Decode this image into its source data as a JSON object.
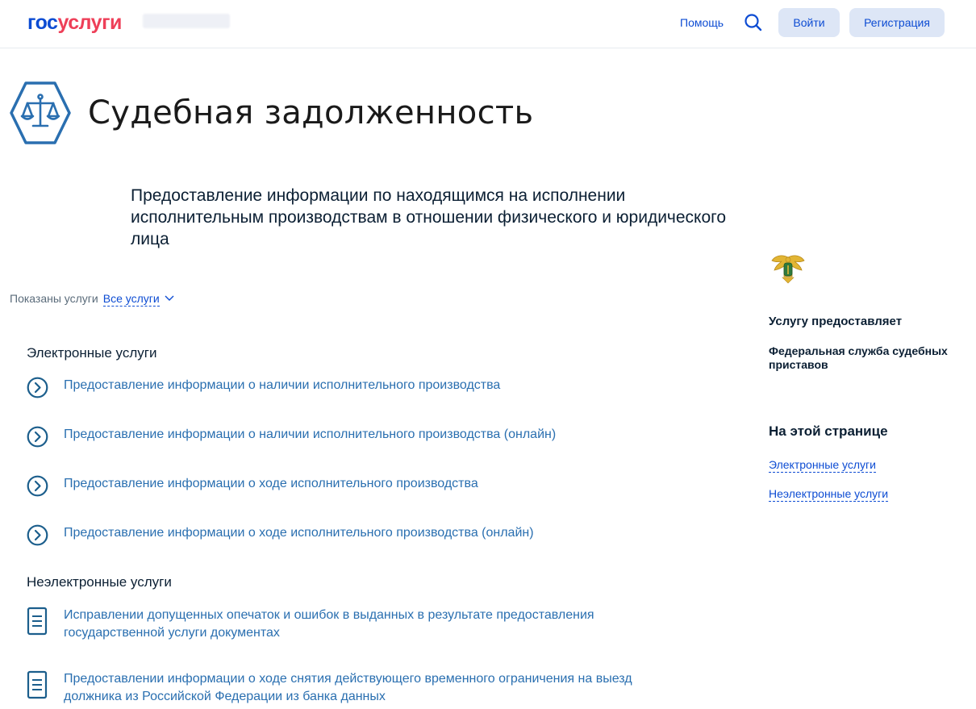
{
  "header": {
    "logo_part1": "гос",
    "logo_part2": "услуги",
    "help_label": "Помощь",
    "login_label": "Войти",
    "register_label": "Регистрация"
  },
  "page": {
    "title": "Судебная задолженность",
    "subtitle": "Предоставление информации по находящимся на исполнении исполнительным производствам в отношении физического и юридического лица"
  },
  "filter": {
    "label": "Показаны услуги",
    "value": "Все услуги"
  },
  "electronic": {
    "title": "Электронные услуги",
    "items": [
      "Предоставление информации о наличии исполнительного производства",
      "Предоставление информации о наличии исполнительного производства (онлайн)",
      "Предоставление информации о ходе исполнительного производства",
      "Предоставление информации о ходе исполнительного производства (онлайн)"
    ]
  },
  "nonelectronic": {
    "title": "Неэлектронные услуги",
    "items": [
      "Исправлении допущенных опечаток и ошибок в выданных в результате предоставления государственной услуги документах",
      "Предоставлении информации о ходе снятия действующего временного ограничения на выезд должника из Российской Федерации из банка данных"
    ]
  },
  "provider": {
    "label": "Услугу предоставляет",
    "name": "Федеральная служба судебных приставов"
  },
  "on_page": {
    "title": "На этой странице",
    "links": [
      "Электронные услуги",
      "Неэлектронные услуги"
    ]
  },
  "colors": {
    "brand_blue": "#0d4cd3",
    "brand_red": "#ee3f58",
    "link": "#2a6fb0",
    "icon_teal": "#1b5e8c"
  }
}
